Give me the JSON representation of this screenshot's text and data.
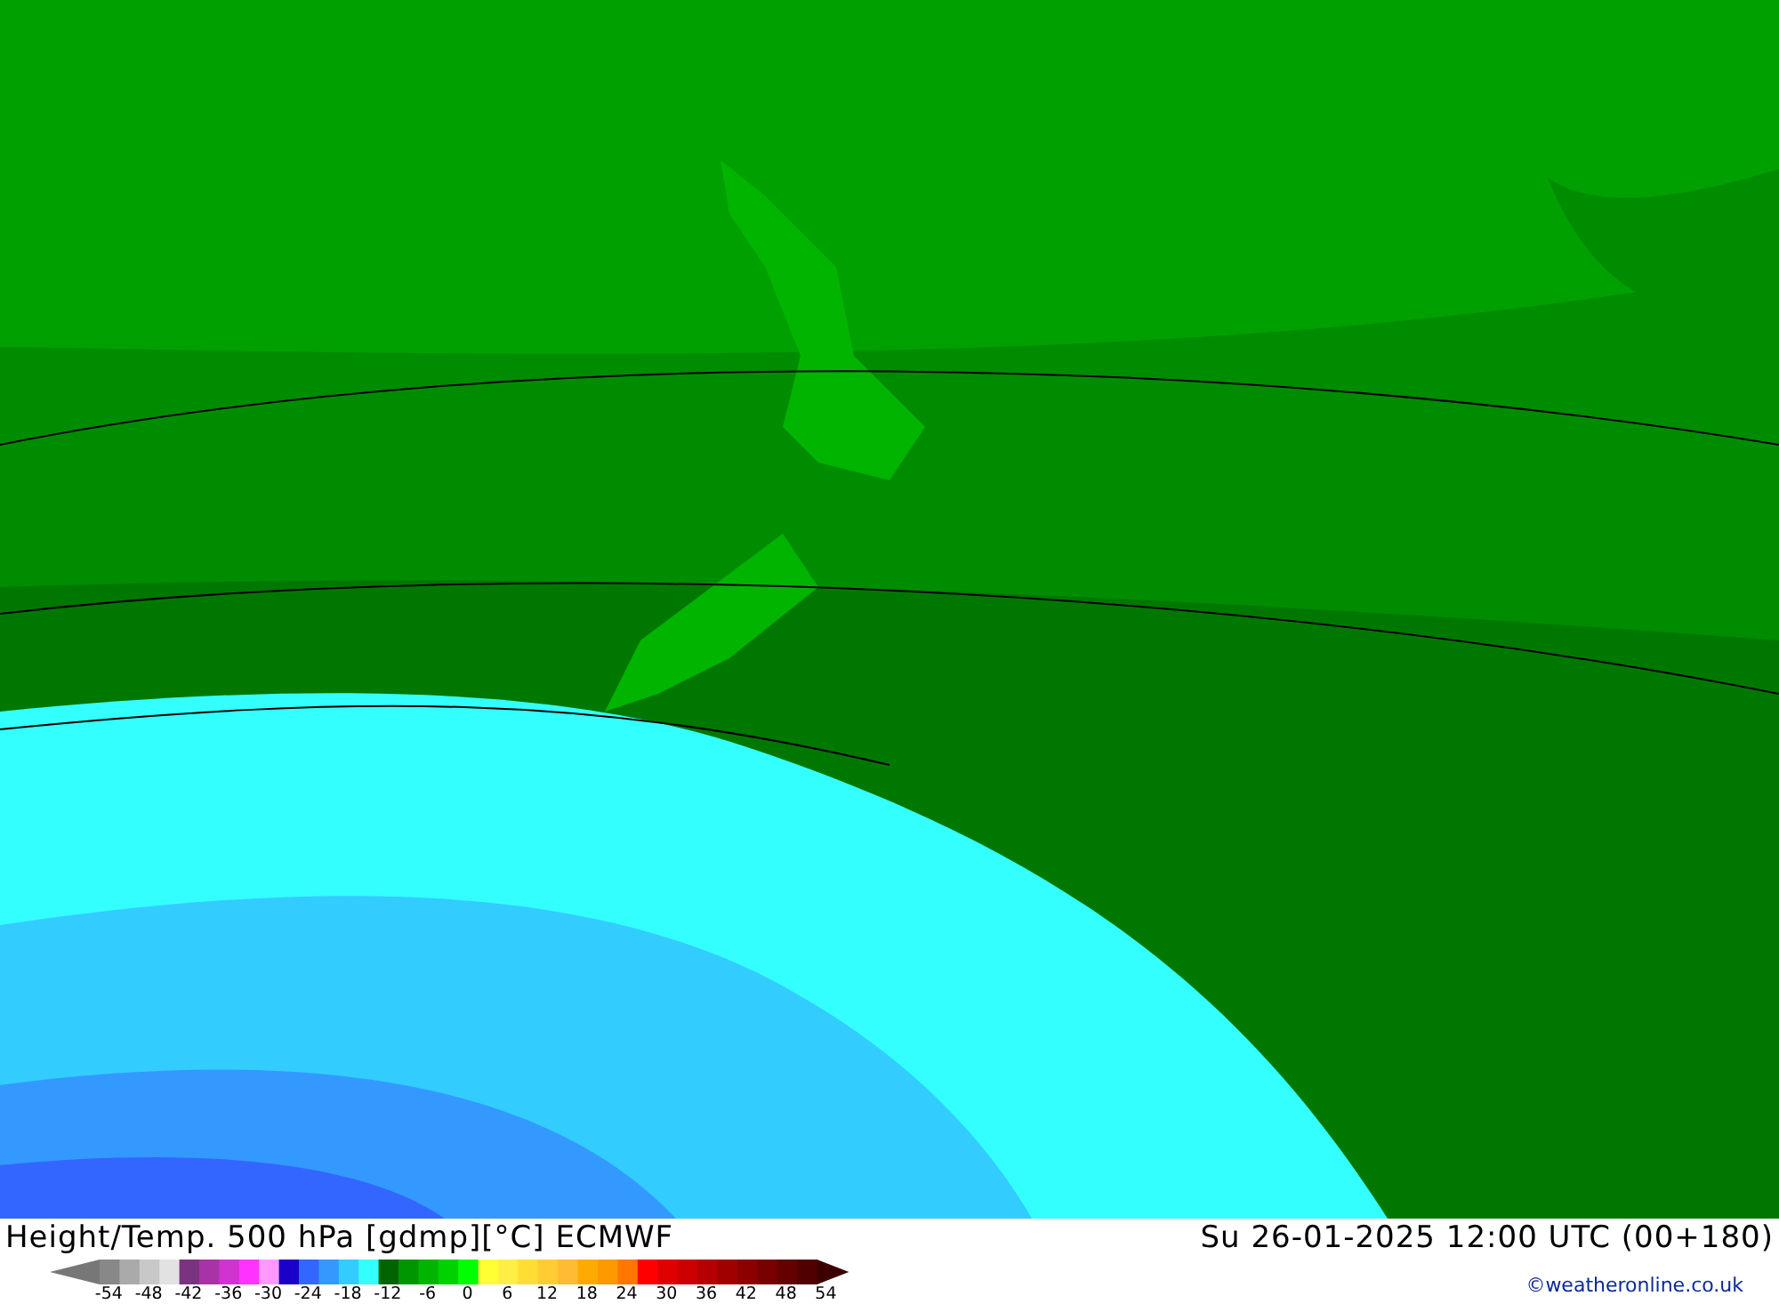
{
  "title": "Height/Temp. 500 hPa [gdmp][°C] ECMWF",
  "valid_time": "Su 26-01-2025 12:00 UTC (00+180)",
  "legend": {
    "swatches": [
      {
        "color": "#888888"
      },
      {
        "color": "#aaaaaa"
      },
      {
        "color": "#c8c8c8"
      },
      {
        "color": "#e2e2e2"
      },
      {
        "color": "#7b3380"
      },
      {
        "color": "#a833a8"
      },
      {
        "color": "#d033d0"
      },
      {
        "color": "#ff33ff"
      },
      {
        "color": "#ff99ff"
      },
      {
        "color": "#1a00c8"
      },
      {
        "color": "#3366ff"
      },
      {
        "color": "#3399ff"
      },
      {
        "color": "#33ccff"
      },
      {
        "color": "#33ffff"
      },
      {
        "color": "#006400"
      },
      {
        "color": "#009600"
      },
      {
        "color": "#00b400"
      },
      {
        "color": "#00d200"
      },
      {
        "color": "#00ff00"
      },
      {
        "color": "#ffff33"
      },
      {
        "color": "#ffee44"
      },
      {
        "color": "#ffdd33"
      },
      {
        "color": "#ffcc33"
      },
      {
        "color": "#ffbb33"
      },
      {
        "color": "#ffaa00"
      },
      {
        "color": "#ff9900"
      },
      {
        "color": "#ff7700"
      },
      {
        "color": "#ff0000"
      },
      {
        "color": "#e00000"
      },
      {
        "color": "#cc0000"
      },
      {
        "color": "#b40000"
      },
      {
        "color": "#a00000"
      },
      {
        "color": "#8c0000"
      },
      {
        "color": "#780000"
      },
      {
        "color": "#640000"
      },
      {
        "color": "#500000"
      }
    ],
    "ticks": [
      "-54",
      "-48",
      "-42",
      "-36",
      "-30",
      "-24",
      "-18",
      "-12",
      "-6",
      "0",
      "6",
      "12",
      "18",
      "24",
      "30",
      "36",
      "42",
      "48",
      "54"
    ]
  },
  "credit": "©weatheronline.co.uk"
}
